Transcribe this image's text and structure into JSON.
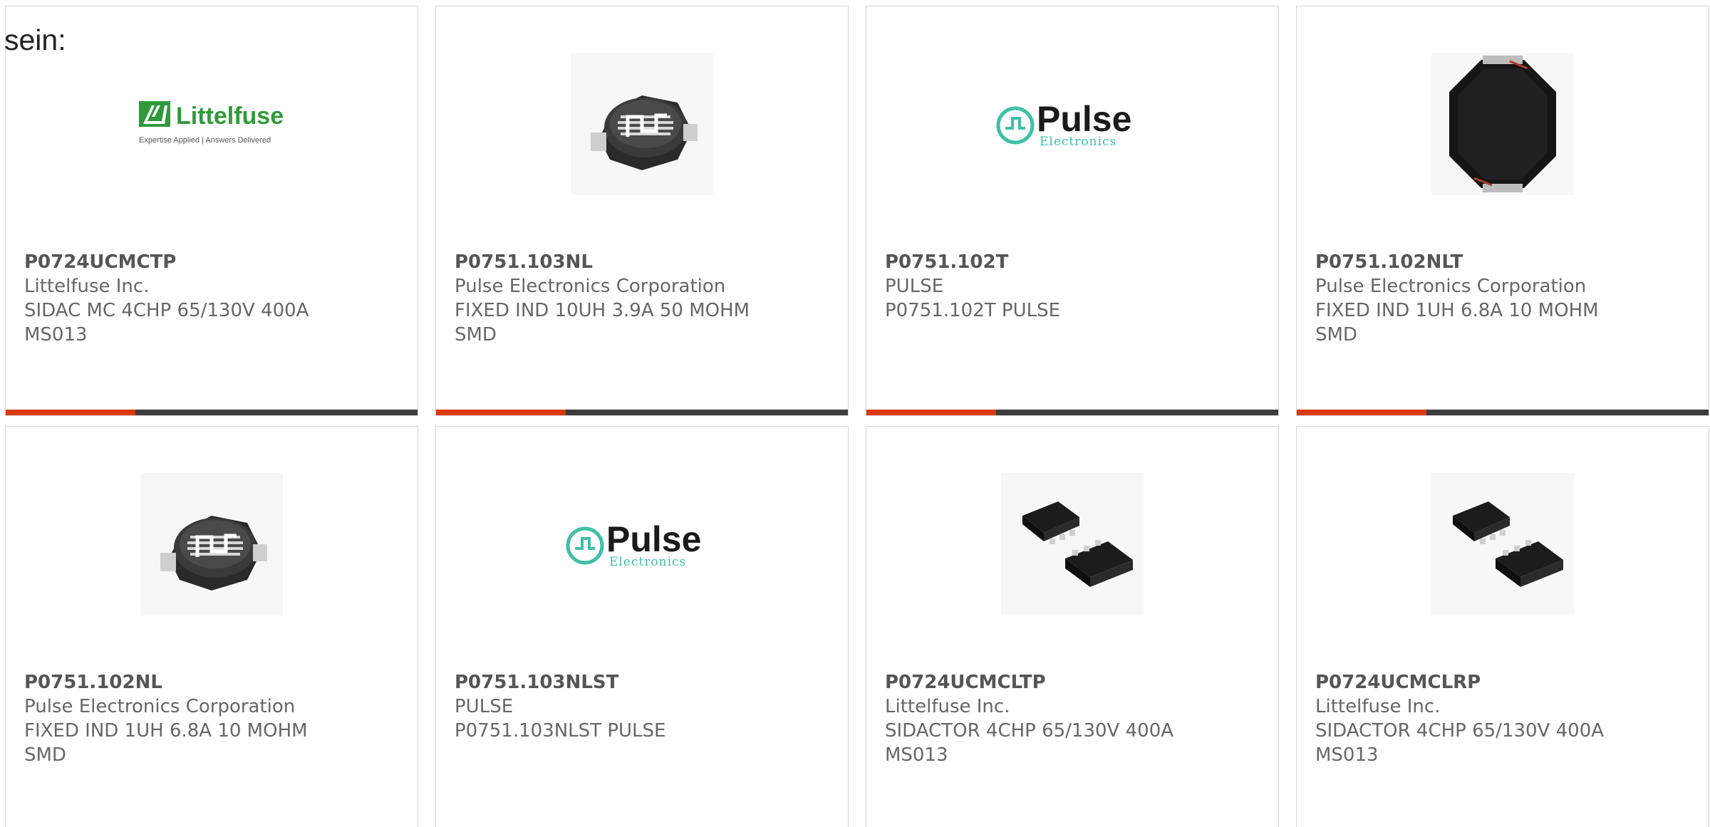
{
  "intro_text": "sein:",
  "colors": {
    "card_border": "#d6d6d6",
    "bar_dark": "#3d3d3d",
    "bar_accent": "#d9390f",
    "text": "#666666",
    "littelfuse_green": "#2f9a3a",
    "pulse_teal": "#3fbfa8"
  },
  "logos": {
    "littelfuse": {
      "name": "Littelfuse",
      "tagline": "Expertise Applied | Answers Delivered"
    },
    "pulse": {
      "name": "Pulse",
      "sub": "Electronics"
    }
  },
  "products": [
    {
      "part_number": "P0724UCMCTP",
      "manufacturer": "Littelfuse Inc.",
      "desc1": "SIDAC MC 4CHP 65/130V 400A",
      "desc2": "MS013",
      "image": "littelfuse-logo"
    },
    {
      "part_number": "P0751.103NL",
      "manufacturer": "Pulse Electronics Corporation",
      "desc1": "FIXED IND 10UH 3.9A 50 MOHM",
      "desc2": "SMD",
      "image": "smd-inductor-photo"
    },
    {
      "part_number": "P0751.102T",
      "manufacturer": "PULSE",
      "desc1": "P0751.102T PULSE",
      "desc2": "",
      "image": "pulse-logo"
    },
    {
      "part_number": "P0751.102NLT",
      "manufacturer": "Pulse Electronics Corporation",
      "desc1": "FIXED IND 1UH 6.8A 10 MOHM",
      "desc2": "SMD",
      "image": "octagon-inductor-photo"
    },
    {
      "part_number": "P0751.102NL",
      "manufacturer": "Pulse Electronics Corporation",
      "desc1": "FIXED IND 1UH 6.8A 10 MOHM",
      "desc2": "SMD",
      "image": "smd-inductor-photo"
    },
    {
      "part_number": "P0751.103NLST",
      "manufacturer": "PULSE",
      "desc1": "P0751.103NLST PULSE",
      "desc2": "",
      "image": "pulse-logo"
    },
    {
      "part_number": "P0724UCMCLTP",
      "manufacturer": "Littelfuse Inc.",
      "desc1": "SIDACTOR 4CHP 65/130V 400A",
      "desc2": "MS013",
      "image": "ic-chips-photo"
    },
    {
      "part_number": "P0724UCMCLRP",
      "manufacturer": "Littelfuse Inc.",
      "desc1": "SIDACTOR 4CHP 65/130V 400A",
      "desc2": "MS013",
      "image": "ic-chips-photo"
    }
  ]
}
